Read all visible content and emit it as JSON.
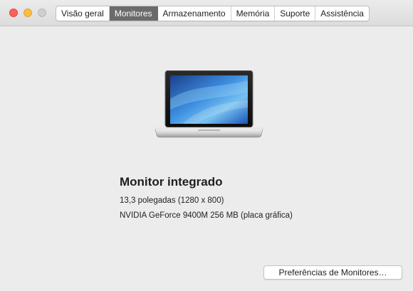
{
  "window": {
    "controls": [
      "close",
      "minimize",
      "zoom"
    ]
  },
  "tabs": [
    {
      "label": "Visão geral",
      "active": false
    },
    {
      "label": "Monitores",
      "active": true
    },
    {
      "label": "Armazenamento",
      "active": false
    },
    {
      "label": "Memória",
      "active": false
    },
    {
      "label": "Suporte",
      "active": false
    },
    {
      "label": "Assistência",
      "active": false
    }
  ],
  "display": {
    "image": "laptop-icon",
    "title": "Monitor integrado",
    "size_resolution": "13,3 polegadas (1280 x 800)",
    "graphics": "NVIDIA GeForce 9400M 256 MB (placa gráfica)"
  },
  "actions": {
    "preferences_button": "Preferências de Monitores…"
  },
  "colors": {
    "background": "#ececec",
    "active_tab": "#6b6b6b",
    "close": "#fc605c",
    "minimize": "#fdbc40",
    "zoom_disabled": "#cfcfcf"
  }
}
